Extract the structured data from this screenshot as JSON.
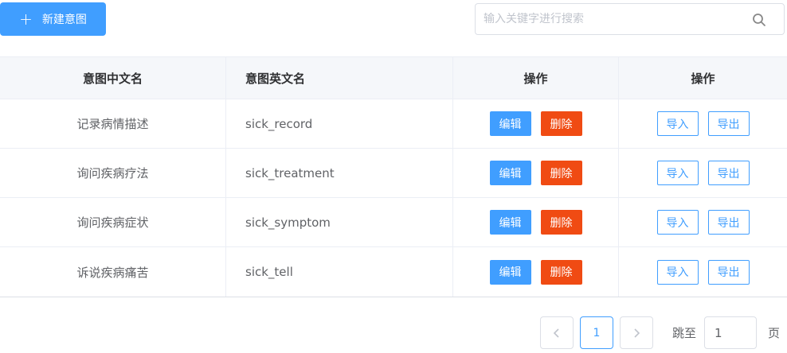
{
  "toolbar": {
    "new_button_icon": "plus-icon",
    "new_button_label": "新建意图",
    "search_placeholder": "输入关键字进行搜索",
    "search_value": "",
    "search_icon": "search-icon"
  },
  "table": {
    "headers": [
      "意图中文名",
      "意图英文名",
      "操作",
      "操作"
    ],
    "rows": [
      {
        "cn": "记录病情描述",
        "en": "sick_record"
      },
      {
        "cn": "询问疾病疗法",
        "en": "sick_treatment"
      },
      {
        "cn": "询问疾病症状",
        "en": "sick_symptom"
      },
      {
        "cn": "诉说疾病痛苦",
        "en": "sick_tell"
      }
    ],
    "actions": {
      "edit": "编辑",
      "delete": "删除",
      "import": "导入",
      "export": "导出"
    }
  },
  "pagination": {
    "prev_icon": "chevron-left-icon",
    "next_icon": "chevron-right-icon",
    "current_page": "1",
    "jump_label": "跳至",
    "jump_value": "1",
    "page_unit": "页"
  },
  "colors": {
    "primary": "#409eff",
    "danger": "#f04b13"
  }
}
